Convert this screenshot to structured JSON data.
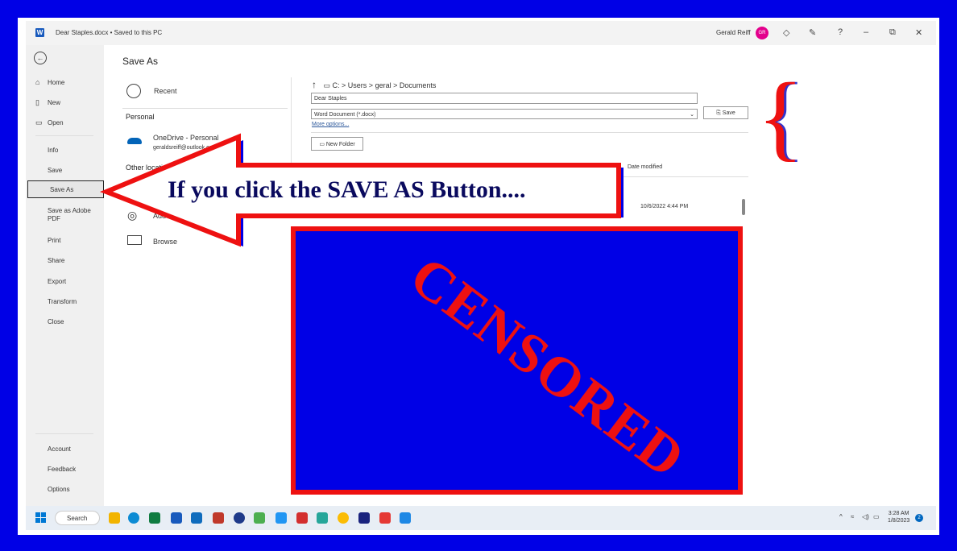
{
  "window": {
    "doc_title": "Dear Staples.docx • Saved to this PC",
    "app_icon": "W",
    "user_name": "Gerald Reiff",
    "avatar_initials": "GR",
    "controls": {
      "help": "?",
      "minimize": "–",
      "restore": "⧉",
      "close": "✕"
    }
  },
  "backstage": {
    "items": [
      {
        "label": "Home",
        "icon": "home-icon"
      },
      {
        "label": "New",
        "icon": "new-document-icon"
      },
      {
        "label": "Open",
        "icon": "open-folder-icon"
      },
      {
        "label": "Info"
      },
      {
        "label": "Save"
      },
      {
        "label": "Save As",
        "selected": true
      },
      {
        "label": "Save as Adobe PDF"
      },
      {
        "label": "Print"
      },
      {
        "label": "Share"
      },
      {
        "label": "Export"
      },
      {
        "label": "Transform"
      },
      {
        "label": "Close"
      }
    ],
    "footer": [
      {
        "label": "Account"
      },
      {
        "label": "Feedback"
      },
      {
        "label": "Options"
      }
    ]
  },
  "saveas": {
    "title": "Save As",
    "recent": "Recent",
    "personal_heading": "Personal",
    "onedrive_name": "OneDrive - Personal",
    "onedrive_email": "geraldsreiff@outlook.co",
    "other_heading": "Other locatio",
    "add_label": "Add",
    "browse": "Browse",
    "path": "C: > Users > geral > Documents",
    "filename": "Dear Staples",
    "filetype": "Word Document (*.docx)",
    "save_button": "Save",
    "more_options": "More options...",
    "new_folder": "New Folder",
    "col_date": "Date modified",
    "file_date": "10/6/2022 4:44 PM"
  },
  "annotation": {
    "arrow_text": "If you click the SAVE AS Button....",
    "censor_text": "CENSORED",
    "brace": "{",
    "colors": {
      "red": "#ee1111",
      "blue": "#0000e6"
    }
  },
  "taskbar": {
    "search": "Search",
    "time": "3:28 AM",
    "date": "1/8/2023",
    "notifications": "2"
  }
}
